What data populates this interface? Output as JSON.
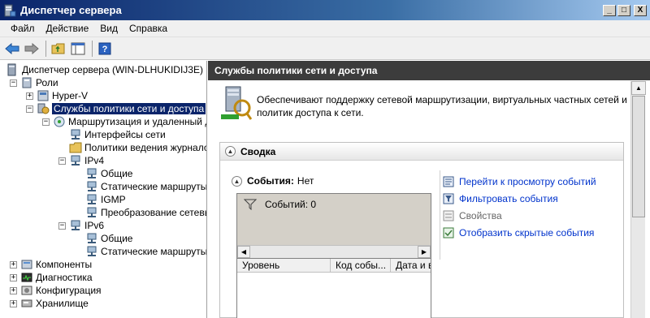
{
  "window": {
    "title": "Диспетчер сервера"
  },
  "window_buttons": {
    "minimize": "_",
    "maximize": "□",
    "close": "X"
  },
  "menu": [
    "Файл",
    "Действие",
    "Вид",
    "Справка"
  ],
  "toolbar": {
    "icons": [
      "back-arrow-icon",
      "forward-arrow-icon",
      "up-folder-icon",
      "show-hide-tree-icon",
      "help-icon"
    ]
  },
  "tree": {
    "root": "Диспетчер сервера (WIN-DLHUKIDIJ3E)",
    "roles": "Роли",
    "hyperv": "Hyper-V",
    "npas": "Службы политики сети и доступа",
    "routing": "Маршрутизация и удаленный до",
    "interfaces": "Интерфейсы сети",
    "logging": "Политики ведения журналов",
    "ipv4": "IPv4",
    "ipv4_general": "Общие",
    "ipv4_static": "Статические маршруты",
    "igmp": "IGMP",
    "nat": "Преобразование сетевых",
    "ipv6": "IPv6",
    "ipv6_general": "Общие",
    "ipv6_static": "Статические маршруты",
    "components": "Компоненты",
    "diagnostics": "Диагностика",
    "configuration": "Конфигурация",
    "storage": "Хранилище"
  },
  "right": {
    "header": "Службы политики сети и доступа",
    "description": "Обеспечивают поддержку сетевой маршрутизации, виртуальных частных сетей и политик доступа к сети.",
    "summary_title": "Сводка",
    "events_label": "События:",
    "events_value": "Нет",
    "filter_text": "Событий: 0",
    "columns": [
      "Уровень",
      "Код собы...",
      "Дата и в"
    ],
    "actions": [
      {
        "label": "Перейти к просмотру событий",
        "enabled": true
      },
      {
        "label": "Фильтровать события",
        "enabled": true
      },
      {
        "label": "Свойства",
        "enabled": false
      },
      {
        "label": "Отобразить скрытые события",
        "enabled": true
      }
    ]
  },
  "colors": {
    "selection": "#0a246a",
    "header_bg": "#3c3c3c",
    "link": "#0033cc"
  }
}
